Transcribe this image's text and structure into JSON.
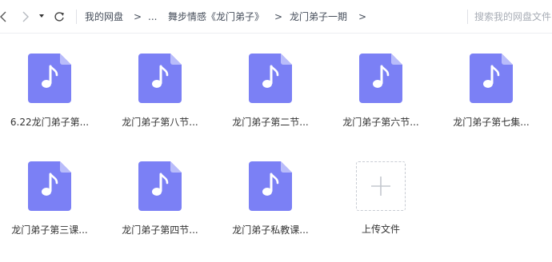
{
  "breadcrumb": {
    "root": "我的网盘",
    "sep": ">",
    "ellipsis": "...",
    "parent": "舞步情感《龙门弟子》",
    "current": "龙门弟子一期"
  },
  "search": {
    "placeholder": "搜索我的网盘文件"
  },
  "colors": {
    "accent": "#7b80f5",
    "fold": "#b9bcfa"
  },
  "files": [
    {
      "name": "6.22龙门弟子第...",
      "icon": "music-file-icon"
    },
    {
      "name": "龙门弟子第八节...",
      "icon": "music-file-icon"
    },
    {
      "name": "龙门弟子第二节...",
      "icon": "music-file-icon"
    },
    {
      "name": "龙门弟子第六节...",
      "icon": "music-file-icon"
    },
    {
      "name": "龙门弟子第七集...",
      "icon": "music-file-icon"
    },
    {
      "name": "龙门弟子第三课...",
      "icon": "music-file-icon"
    },
    {
      "name": "龙门弟子第四节...",
      "icon": "music-file-icon"
    },
    {
      "name": "龙门弟子私教课...",
      "icon": "music-file-icon"
    }
  ],
  "upload": {
    "label": "上传文件",
    "icon": "plus-icon"
  }
}
